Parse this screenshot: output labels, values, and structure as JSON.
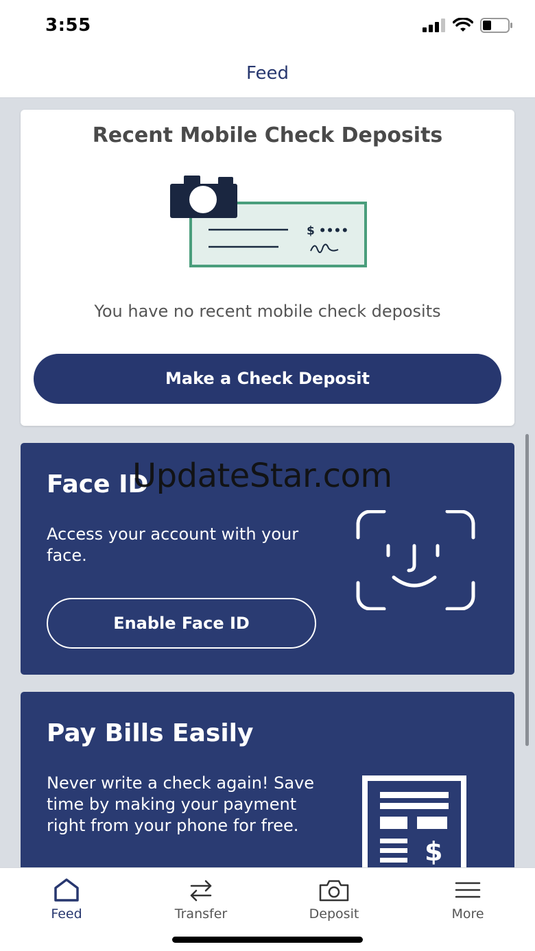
{
  "status_bar": {
    "time": "3:55",
    "icons": [
      "signal-icon",
      "wifi-icon",
      "battery-icon"
    ]
  },
  "header": {
    "title": "Feed"
  },
  "deposits_card": {
    "title": "Recent Mobile Check Deposits",
    "illustration": "camera-check-illustration",
    "check_amount": "$ ••••",
    "message": "You have no recent mobile check deposits",
    "button_label": "Make a Check Deposit"
  },
  "faceid_card": {
    "title": "Face ID",
    "body": "Access your account with your face.",
    "button_label": "Enable Face ID",
    "illustration": "face-id-icon"
  },
  "bills_card": {
    "title": "Pay Bills Easily",
    "body": "Never write a check again! Save time by making your payment right from your phone for free.",
    "illustration": "bill-document-icon"
  },
  "watermark": "UpdateStar.com",
  "tabs": [
    {
      "label": "Feed",
      "icon": "home-icon",
      "active": true
    },
    {
      "label": "Transfer",
      "icon": "transfer-arrows-icon",
      "active": false
    },
    {
      "label": "Deposit",
      "icon": "camera-icon",
      "active": false
    },
    {
      "label": "More",
      "icon": "menu-icon",
      "active": false
    }
  ],
  "colors": {
    "primary": "#27376f",
    "card_blue": "#2a3b72",
    "check_green": "#4a9e7c",
    "background": "#d9dde3"
  }
}
